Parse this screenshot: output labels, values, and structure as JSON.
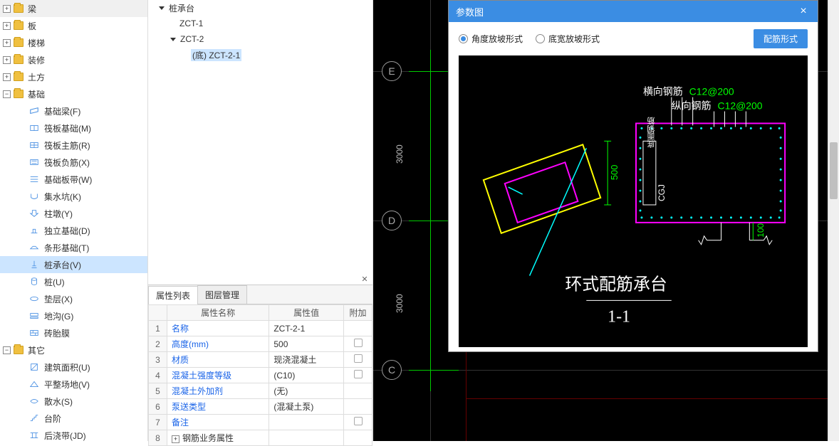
{
  "sidebar": {
    "cat_beam": "梁",
    "cat_slab": "板",
    "cat_stair": "楼梯",
    "cat_finish": "装修",
    "cat_earth": "土方",
    "cat_foundation": "基础",
    "foundation_items": [
      {
        "name": "基础梁(F)"
      },
      {
        "name": "筏板基础(M)"
      },
      {
        "name": "筏板主筋(R)"
      },
      {
        "name": "筏板负筋(X)"
      },
      {
        "name": "基础板带(W)"
      },
      {
        "name": "集水坑(K)"
      },
      {
        "name": "柱墩(Y)"
      },
      {
        "name": "独立基础(D)"
      },
      {
        "name": "条形基础(T)"
      },
      {
        "name": "桩承台(V)"
      },
      {
        "name": "桩(U)"
      },
      {
        "name": "垫层(X)"
      },
      {
        "name": "地沟(G)"
      },
      {
        "name": "砖胎膜"
      }
    ],
    "cat_other": "其它",
    "other_items": [
      {
        "name": "建筑面积(U)"
      },
      {
        "name": "平整场地(V)"
      },
      {
        "name": "散水(S)"
      },
      {
        "name": "台阶"
      },
      {
        "name": "后浇带(JD)"
      }
    ]
  },
  "center_tree": {
    "root": "桩承台",
    "child1": "ZCT-1",
    "child2": "ZCT-2",
    "leaf": "(底)  ZCT-2-1"
  },
  "prop_panel": {
    "tab1": "属性列表",
    "tab2": "图层管理",
    "col_name": "属性名称",
    "col_value": "属性值",
    "col_extra": "附加",
    "rows": [
      {
        "n": "1",
        "name": "名称",
        "value": "ZCT-2-1",
        "chk": false,
        "blue": true
      },
      {
        "n": "2",
        "name": "高度(mm)",
        "value": "500",
        "chk": true,
        "blue": true
      },
      {
        "n": "3",
        "name": "材质",
        "value": "现浇混凝土",
        "chk": true,
        "blue": true
      },
      {
        "n": "4",
        "name": "混凝土强度等级",
        "value": "(C10)",
        "chk": true,
        "blue": true
      },
      {
        "n": "5",
        "name": "混凝土外加剂",
        "value": "(无)",
        "chk": false,
        "blue": true
      },
      {
        "n": "6",
        "name": "泵送类型",
        "value": "(混凝土泵)",
        "chk": false,
        "blue": true
      },
      {
        "n": "7",
        "name": "备注",
        "value": "",
        "chk": true,
        "blue": true
      },
      {
        "n": "8",
        "name": "钢筋业务属性",
        "value": "",
        "chk": false,
        "blue": false,
        "collapse": true
      }
    ]
  },
  "canvas": {
    "bubble_e": "E",
    "bubble_d": "D",
    "bubble_c": "C",
    "dim_3000_1": "3000",
    "dim_3000_2": "3000"
  },
  "dialog": {
    "title": "参数图",
    "opt1": "角度放坡形式",
    "opt2": "底宽放坡形式",
    "btn": "配筋形式",
    "label_h": "横向钢筋",
    "label_h_val": "C12@200",
    "label_v": "纵向钢筋",
    "label_v_val": "C12@200",
    "label_side": "底面钢筋",
    "label_cgj": "CGJ",
    "dim_500": "500",
    "dim_100": "100",
    "title_big": "环式配筋承台",
    "section": "1-1"
  }
}
